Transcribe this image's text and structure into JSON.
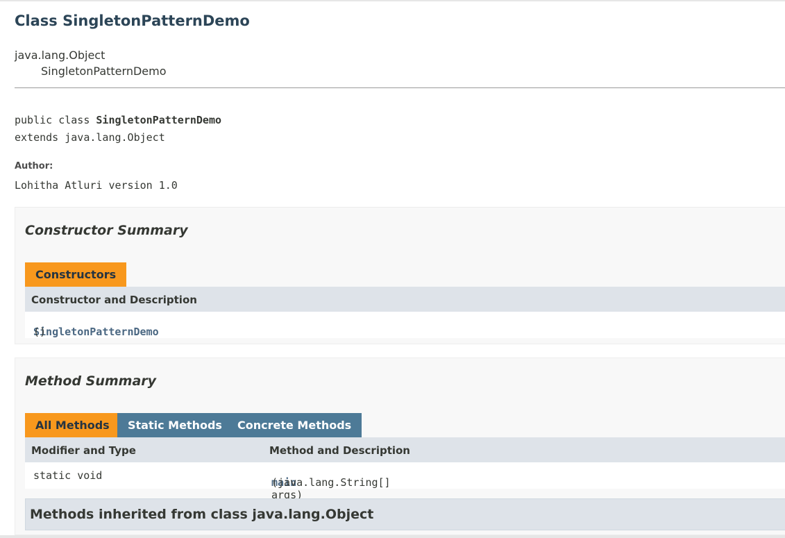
{
  "header": {
    "class_title": "Class SingletonPatternDemo",
    "inheritance": [
      "java.lang.Object",
      "SingletonPatternDemo"
    ]
  },
  "declaration": {
    "line1_prefix": "public class ",
    "line1_name": "SingletonPatternDemo",
    "line2": "extends java.lang.Object"
  },
  "author": {
    "label": "Author:",
    "value": "Lohitha Atluri version 1.0"
  },
  "constructor_summary": {
    "heading": "Constructor Summary",
    "tab": "Constructors",
    "column_header": "Constructor and Description",
    "rows": [
      {
        "name": "SingletonPatternDemo",
        "params": "()"
      }
    ]
  },
  "method_summary": {
    "heading": "Method Summary",
    "tabs": [
      "All Methods",
      "Static Methods",
      "Concrete Methods"
    ],
    "columns": [
      "Modifier and Type",
      "Method and Description"
    ],
    "rows": [
      {
        "modifier": "static void",
        "name": "main",
        "params": "(java.lang.String[] args)"
      }
    ],
    "inherited_heading": "Methods inherited from class java.lang.Object"
  },
  "colors": {
    "active_tab": "#f8981d",
    "inactive_tab": "#4d7a97",
    "table_header": "#dee3e9",
    "title": "#2c4557",
    "link": "#4a6782"
  }
}
